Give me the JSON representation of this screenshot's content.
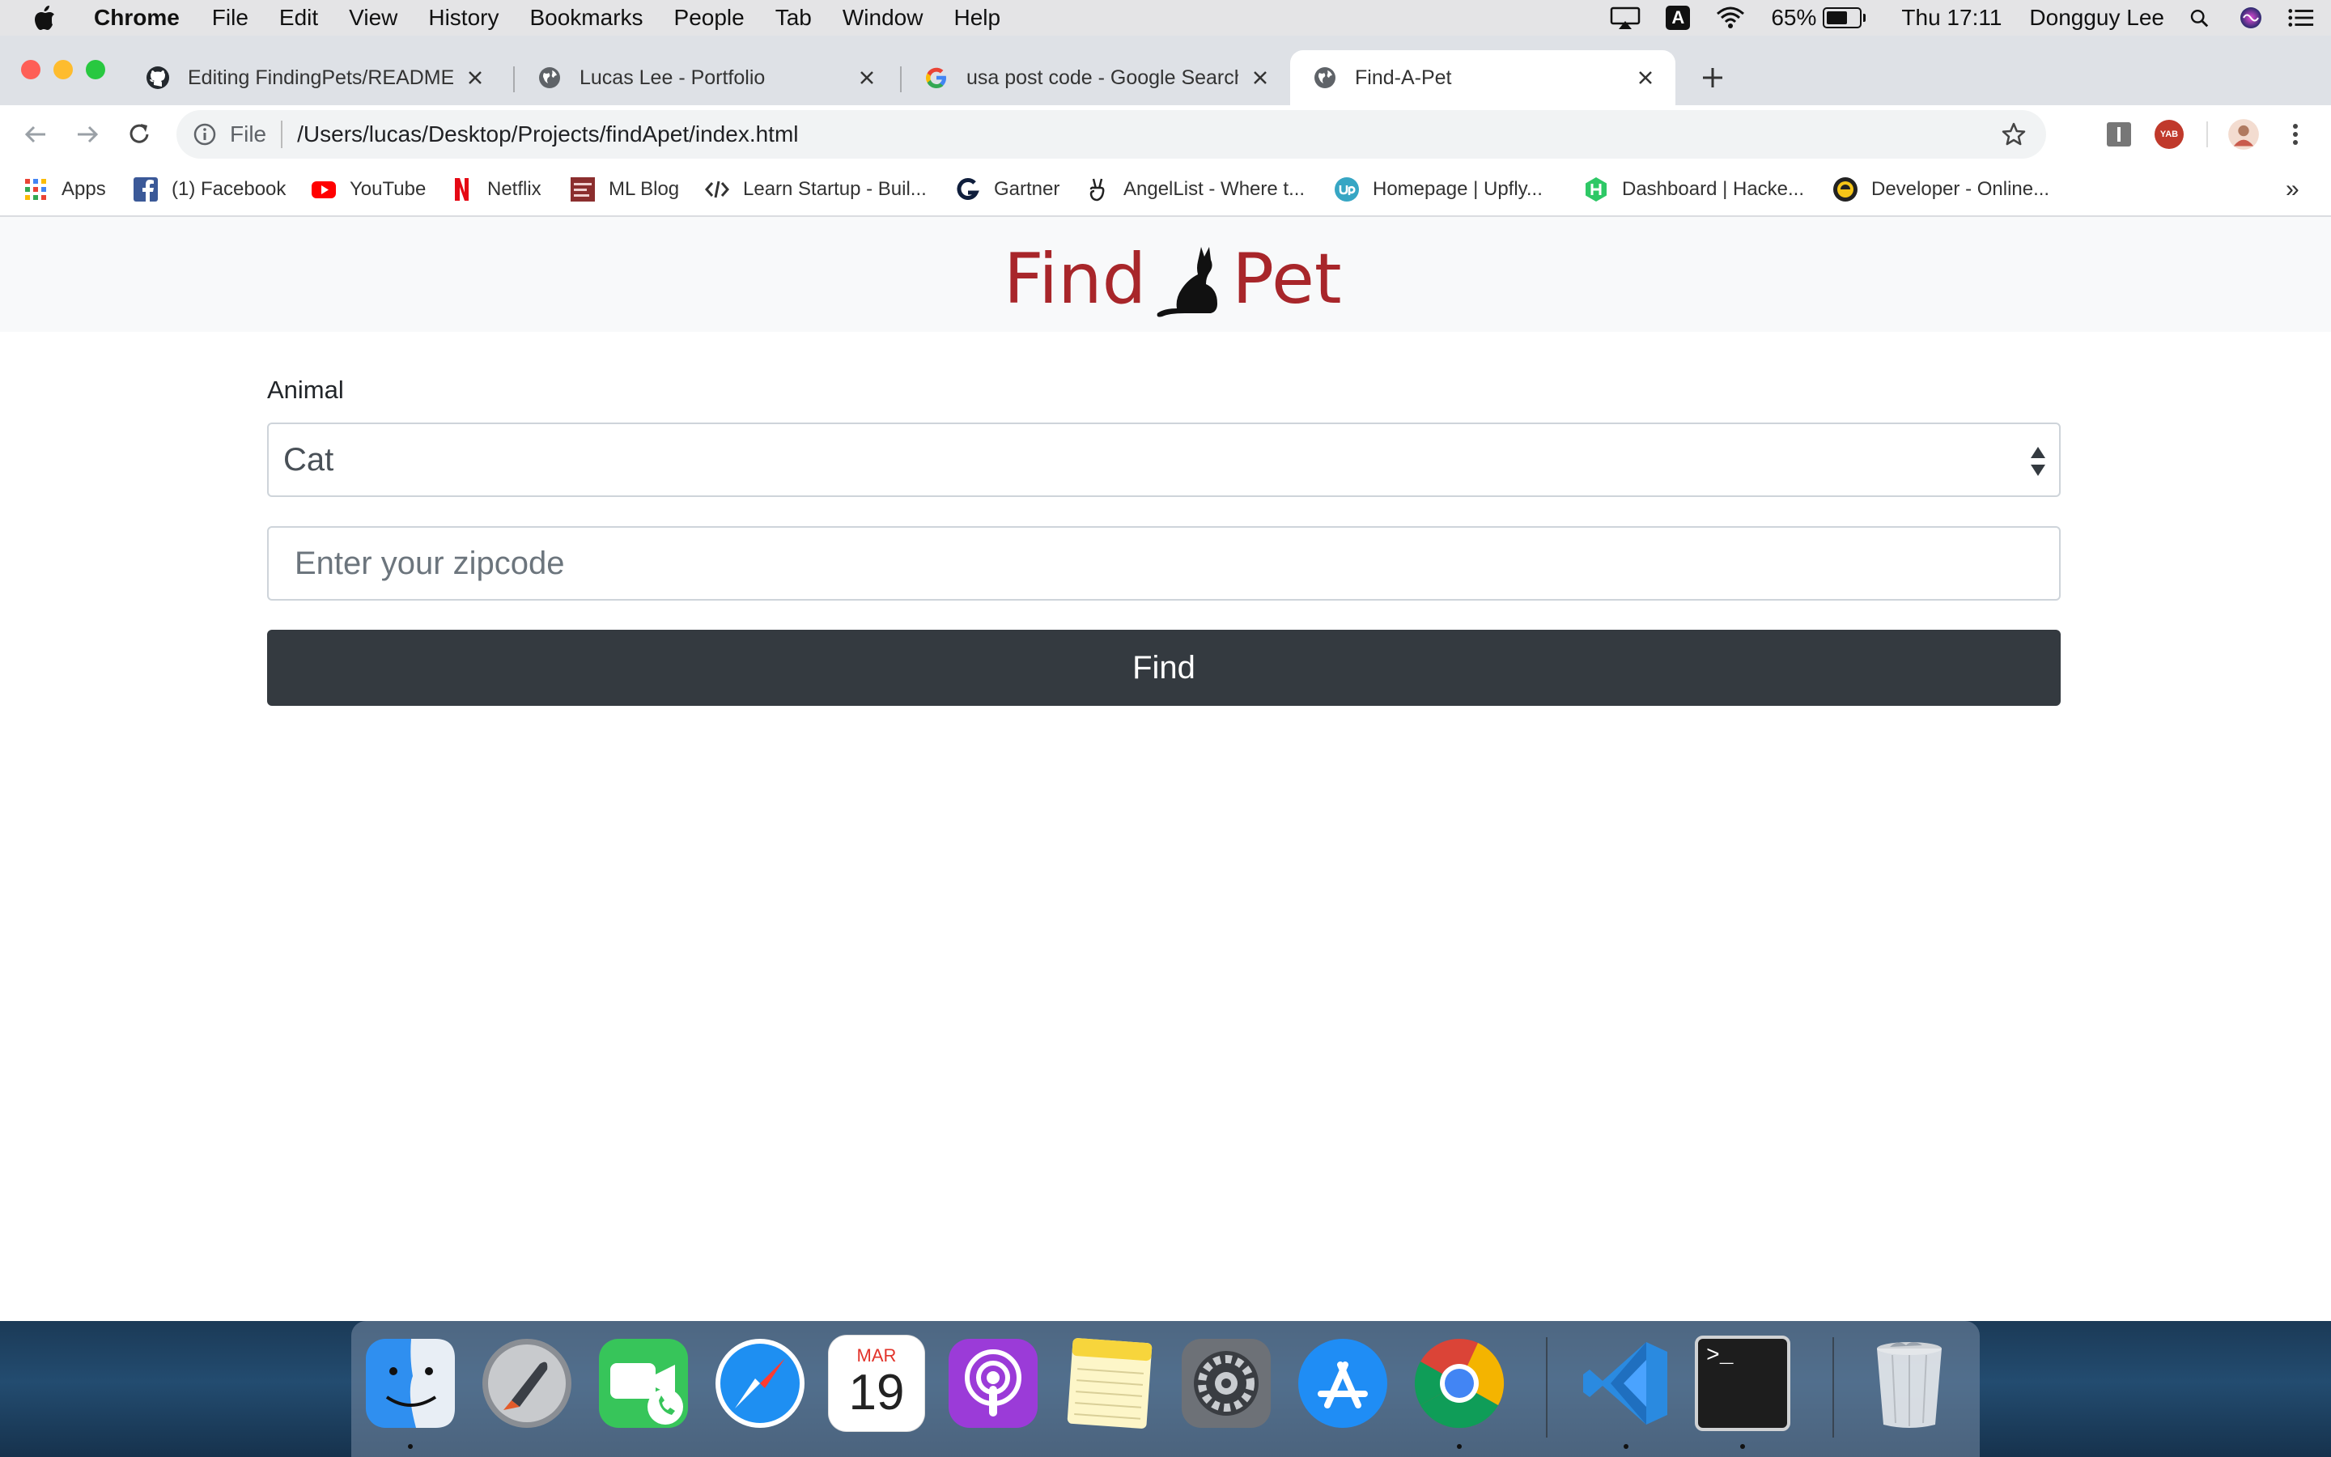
{
  "menubar": {
    "items": [
      "Chrome",
      "File",
      "Edit",
      "View",
      "History",
      "Bookmarks",
      "People",
      "Tab",
      "Window",
      "Help"
    ],
    "battery_percent": 65,
    "battery_label": "65%",
    "clock": "Thu 17:11",
    "user": "Dongguy Lee",
    "input_badge": "A"
  },
  "tabs": [
    {
      "title": "Editing FindingPets/README.md",
      "icon": "github-icon",
      "active": false
    },
    {
      "title": "Lucas Lee - Portfolio",
      "icon": "globe-icon",
      "active": false
    },
    {
      "title": "usa post code - Google Search",
      "icon": "google-icon",
      "active": false
    },
    {
      "title": "Find-A-Pet",
      "icon": "globe-icon",
      "active": true
    }
  ],
  "toolbar": {
    "scheme": "File",
    "url": "/Users/lucas/Desktop/Projects/findApet/index.html",
    "ext_yab": "YAB"
  },
  "bookmarks": [
    {
      "label": "Apps",
      "icon": "apps-grid-icon"
    },
    {
      "label": "(1) Facebook",
      "icon": "facebook-icon"
    },
    {
      "label": "YouTube",
      "icon": "youtube-icon"
    },
    {
      "label": "Netflix",
      "icon": "netflix-icon"
    },
    {
      "label": "ML Blog",
      "icon": "nlp-blog-icon"
    },
    {
      "label": "Learn Startup - Buil...",
      "icon": "code-icon"
    },
    {
      "label": "Gartner",
      "icon": "gartner-icon"
    },
    {
      "label": "AngelList - Where t...",
      "icon": "angellist-icon"
    },
    {
      "label": "Homepage | Upfly...",
      "icon": "upwork-icon"
    },
    {
      "label": "Dashboard | Hacke...",
      "icon": "hackerrank-icon"
    },
    {
      "label": "Developer - Online...",
      "icon": "developer-icon"
    }
  ],
  "bookmarks_overflow": "»",
  "page": {
    "logo_left": "Find",
    "logo_right": "Pet",
    "animal_label": "Animal",
    "animal_selected": "Cat",
    "zip_placeholder": "Enter your zipcode",
    "zip_value": "",
    "find_label": "Find",
    "button_color": "#343a40",
    "logo_color": "#a8262a"
  },
  "dock": {
    "apps": [
      "finder-icon",
      "launchpad-icon",
      "facetime-icon",
      "safari-icon",
      "calendar-icon",
      "podcasts-icon",
      "notes-icon",
      "system-preferences-icon",
      "app-store-icon",
      "chrome-icon",
      "vscode-icon",
      "terminal-icon",
      "trash-icon"
    ],
    "calendar_month": "MAR",
    "calendar_day": "19",
    "terminal_prompt": ">_"
  }
}
